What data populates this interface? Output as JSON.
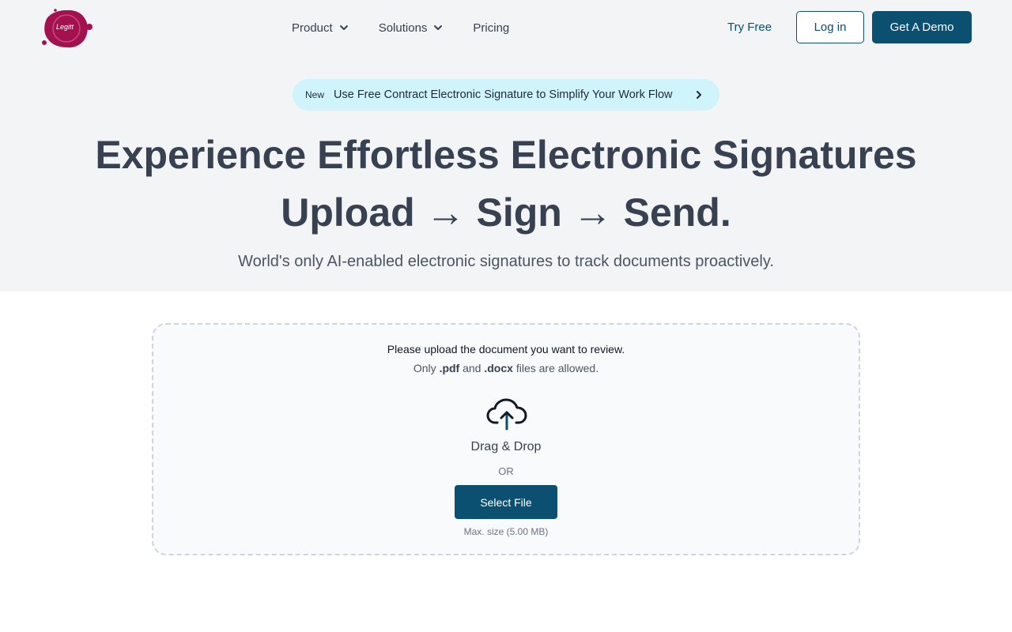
{
  "brand": {
    "logo_text": "Legitt",
    "logo_color": "#a3114f"
  },
  "nav": {
    "product": "Product",
    "solutions": "Solutions",
    "pricing": "Pricing",
    "try_free": "Try Free",
    "login": "Log in",
    "demo": "Get A Demo"
  },
  "announcement": {
    "badge": "New",
    "message": "Use Free Contract Electronic Signature to Simplify Your Work Flow"
  },
  "hero": {
    "headline_line1": "Experience Effortless Electronic Signatures",
    "headline_line2": "Upload → Sign → Send.",
    "subheadline": "World's only AI-enabled electronic signatures to track documents proactively."
  },
  "upload": {
    "instruction": "Please upload the document you want to review.",
    "only": "Only",
    "pdf": ".pdf",
    "and": "and",
    "docx": ".docx",
    "allowed": "files are allowed.",
    "drag_drop": "Drag & Drop",
    "or": "OR",
    "select_file": "Select File",
    "max_size": "Max. size (5.00 MB)"
  },
  "colors": {
    "accent": "#0b5070",
    "hero_bg": "#f3f4f6",
    "announce_bg": "#cff4fc"
  },
  "icons": {
    "product_chevron": "chevron-down-icon",
    "solutions_chevron": "chevron-down-icon",
    "announce_arrow": "chevron-right-icon",
    "upload": "cloud-upload-icon"
  }
}
